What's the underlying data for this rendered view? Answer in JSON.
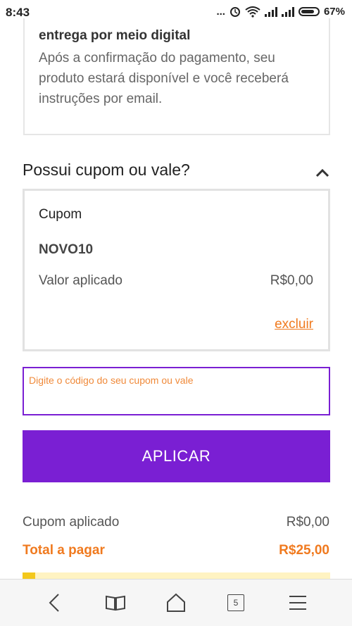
{
  "status_bar": {
    "time": "8:43",
    "dots": "...",
    "battery_percent": "67%"
  },
  "delivery": {
    "title": "entrega por meio digital",
    "description": "Após a confirmação do pagamento, seu produto estará disponível e você receberá instruções por email."
  },
  "coupon_section": {
    "heading": "Possui cupom ou vale?",
    "card": {
      "label": "Cupom",
      "code": "NOVO10",
      "applied_label": "Valor aplicado",
      "applied_value": "R$0,00",
      "remove_label": "excluir"
    },
    "input_placeholder": "Digite o código do seu cupom ou vale",
    "apply_button": "APLICAR"
  },
  "summary": {
    "coupon_label": "Cupom aplicado",
    "coupon_value": "R$0,00",
    "total_label": "Total a pagar",
    "total_value": "R$25,00"
  },
  "browser_bar": {
    "tab_count": "5"
  },
  "colors": {
    "accent_purple": "#7a1fd3",
    "accent_orange": "#f07a1f"
  }
}
